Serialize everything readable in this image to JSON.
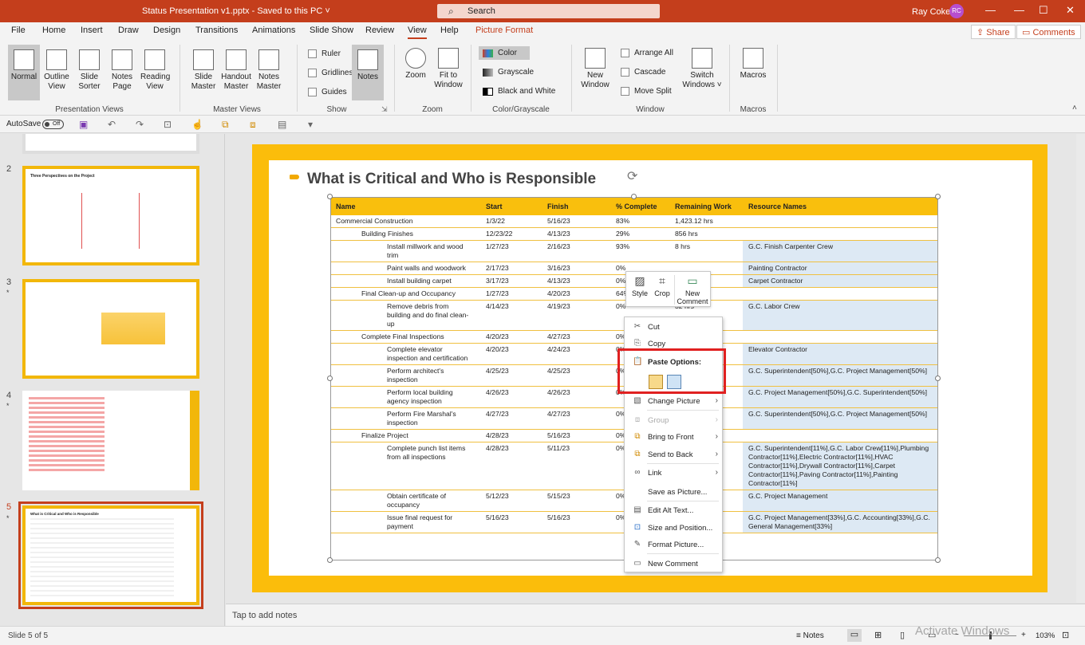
{
  "window": {
    "title": "Status Presentation v1.pptx",
    "saved": "Saved to this PC",
    "search_placeholder": "Search",
    "user_name": "Ray Coker",
    "user_initials": "RC",
    "minimize": "—",
    "restore": "☐",
    "close": "✕"
  },
  "menu_tabs": [
    "File",
    "Home",
    "Insert",
    "Draw",
    "Design",
    "Transitions",
    "Animations",
    "Slide Show",
    "Review",
    "View",
    "Help",
    "Picture Format"
  ],
  "share_label": "Share",
  "comments_label": "Comments",
  "ribbon": {
    "presentation_views": {
      "label": "Presentation Views",
      "normal": "Normal",
      "outline_view_1": "Outline",
      "outline_view_2": "View",
      "slide_sorter_1": "Slide",
      "slide_sorter_2": "Sorter",
      "notes_page_1": "Notes",
      "notes_page_2": "Page",
      "reading_view_1": "Reading",
      "reading_view_2": "View"
    },
    "master_views": {
      "label": "Master Views",
      "slide_master_1": "Slide",
      "slide_master_2": "Master",
      "handout_master_1": "Handout",
      "handout_master_2": "Master",
      "notes_master_1": "Notes",
      "notes_master_2": "Master"
    },
    "show": {
      "label": "Show",
      "ruler": "Ruler",
      "gridlines": "Gridlines",
      "guides": "Guides",
      "notes": "Notes"
    },
    "zoom": {
      "label": "Zoom",
      "zoom": "Zoom",
      "fit_1": "Fit to",
      "fit_2": "Window"
    },
    "color": {
      "label": "Color/Grayscale",
      "color": "Color",
      "grayscale": "Grayscale",
      "bw": "Black and White"
    },
    "window": {
      "label": "Window",
      "new_window_1": "New",
      "new_window_2": "Window",
      "arrange_all": "Arrange All",
      "cascade": "Cascade",
      "move_split": "Move Split",
      "switch_1": "Switch",
      "switch_2": "Windows ˅"
    },
    "macros": {
      "label": "Macros",
      "macros": "Macros"
    }
  },
  "qat": {
    "autosave": "AutoSave",
    "toggle": "Off"
  },
  "thumbnails": [
    {
      "num": "2",
      "star": "",
      "title": "Three Perspectives on the Project"
    },
    {
      "num": "3",
      "star": "*"
    },
    {
      "num": "4",
      "star": "*"
    },
    {
      "num": "5",
      "star": "*",
      "title": "What is Critical and Who is Responsible"
    }
  ],
  "slide": {
    "title": "What is Critical and Who is Responsible",
    "columns": [
      "Name",
      "Start",
      "Finish",
      "% Complete",
      "Remaining Work",
      "Resource Names"
    ],
    "rows": [
      {
        "level": 0,
        "name": "Commercial Construction",
        "start": "1/3/22",
        "finish": "5/16/23",
        "pct": "83%",
        "rem": "1,423.12 hrs",
        "res": ""
      },
      {
        "level": 1,
        "name": "Building Finishes",
        "start": "12/23/22",
        "finish": "4/13/23",
        "pct": "29%",
        "rem": "856 hrs",
        "res": ""
      },
      {
        "level": 2,
        "name": "Install millwork and wood trim",
        "start": "1/27/23",
        "finish": "2/16/23",
        "pct": "93%",
        "rem": "8 hrs",
        "res": "G.C. Finish Carpenter Crew"
      },
      {
        "level": 2,
        "name": "Paint walls and woodwork",
        "start": "2/17/23",
        "finish": "3/16/23",
        "pct": "0%",
        "rem": "",
        "res": "Painting Contractor"
      },
      {
        "level": 2,
        "name": "Install building carpet",
        "start": "3/17/23",
        "finish": "4/13/23",
        "pct": "0%",
        "rem": "",
        "res": "Carpet Contractor"
      },
      {
        "level": 1,
        "name": "Final Clean-up and Occupancy",
        "start": "1/27/23",
        "finish": "4/20/23",
        "pct": "64%",
        "rem": "",
        "res": ""
      },
      {
        "level": 2,
        "name": "Remove debris from building and do final clean-up",
        "start": "4/14/23",
        "finish": "4/19/23",
        "pct": "0%",
        "rem": "32 hrs",
        "res": "G.C. Labor Crew"
      },
      {
        "level": 1,
        "name": "Complete Final Inspections",
        "start": "4/20/23",
        "finish": "4/27/23",
        "pct": "0%",
        "rem": "",
        "res": ""
      },
      {
        "level": 2,
        "name": "Complete elevator inspection and certification",
        "start": "4/20/23",
        "finish": "4/24/23",
        "pct": "0%",
        "rem": "",
        "res": "Elevator Contractor"
      },
      {
        "level": 2,
        "name": "Perform architect's inspection",
        "start": "4/25/23",
        "finish": "4/25/23",
        "pct": "0%",
        "rem": "",
        "res": "G.C. Superintendent[50%],G.C. Project Management[50%]"
      },
      {
        "level": 2,
        "name": "Perform local building agency inspection",
        "start": "4/26/23",
        "finish": "4/26/23",
        "pct": "0%",
        "rem": "",
        "res": "G.C. Project Management[50%],G.C. Superintendent[50%]"
      },
      {
        "level": 2,
        "name": "Perform Fire Marshal's inspection",
        "start": "4/27/23",
        "finish": "4/27/23",
        "pct": "0%",
        "rem": "",
        "res": "G.C. Superintendent[50%],G.C. Project Management[50%]"
      },
      {
        "level": 1,
        "name": "Finalize Project",
        "start": "4/28/23",
        "finish": "5/16/23",
        "pct": "0%",
        "rem": "",
        "res": ""
      },
      {
        "level": 2,
        "name": "Complete punch list items from all inspections",
        "start": "4/28/23",
        "finish": "5/11/23",
        "pct": "0%",
        "rem": "",
        "res": "G.C. Superintendent[11%],G.C. Labor Crew[11%],Plumbing Contractor[11%],Electric Contractor[11%],HVAC Contractor[11%],Drywall Contractor[11%],Carpet Contractor[11%],Paving Contractor[11%],Painting Contractor[11%]"
      },
      {
        "level": 2,
        "name": "Obtain certificate of occupancy",
        "start": "5/12/23",
        "finish": "5/15/23",
        "pct": "0%",
        "rem": "",
        "res": "G.C. Project Management"
      },
      {
        "level": 2,
        "name": "Issue final request for payment",
        "start": "5/16/23",
        "finish": "5/16/23",
        "pct": "0%",
        "rem": "",
        "res": "G.C. Project Management[33%],G.C. Accounting[33%],G.C. General Management[33%]"
      }
    ]
  },
  "mini_toolbar": {
    "style": "Style",
    "crop": "Crop",
    "new_comment_1": "New",
    "new_comment_2": "Comment"
  },
  "context_menu": {
    "cut": "Cut",
    "copy": "Copy",
    "paste_options": "Paste Options:",
    "change_picture": "Change Picture",
    "group": "Group",
    "bring_to_front": "Bring to Front",
    "send_to_back": "Send to Back",
    "link": "Link",
    "save_as_picture": "Save as Picture...",
    "edit_alt_text": "Edit Alt Text...",
    "size_and_position": "Size and Position...",
    "format_picture": "Format Picture...",
    "new_comment": "New Comment"
  },
  "notes_placeholder": "Tap to add notes",
  "status": {
    "slide_info": "Slide 5 of 5",
    "notes": "Notes",
    "zoom": "103%",
    "watermark": "Activate Windows"
  },
  "colors": {
    "accent": "#c43e1c",
    "slide_border": "#fbbd0b",
    "highlight": "#e02020"
  }
}
